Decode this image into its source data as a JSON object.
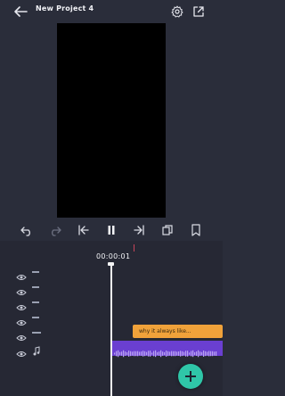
{
  "header": {
    "title": "New Project 4",
    "back_icon": "arrow-left-icon",
    "settings_icon": "gear-icon",
    "export_icon": "export-icon"
  },
  "controls": {
    "undo_icon": "undo-icon",
    "redo_icon": "redo-icon",
    "skip_start_icon": "skip-to-start-icon",
    "pause_icon": "pause-icon",
    "skip_end_icon": "skip-to-end-icon",
    "copy_icon": "copy-icon",
    "bookmark_icon": "bookmark-icon"
  },
  "timeline": {
    "timecode": "00:00:01",
    "tracks": [
      {
        "visibility_icon": "eye-icon"
      },
      {
        "visibility_icon": "eye-icon"
      },
      {
        "visibility_icon": "eye-icon"
      },
      {
        "visibility_icon": "eye-icon"
      },
      {
        "visibility_icon": "eye-icon"
      },
      {
        "visibility_icon": "eye-icon",
        "type_icon": "music-note-icon"
      }
    ],
    "caption_clip_text": "why it always like... ",
    "caption_clip_color": "#f0a23a",
    "audio_clip_color": "#6a3fd1"
  },
  "fab": {
    "icon": "plus-icon",
    "color": "#2fc6a8"
  },
  "colors": {
    "background": "#2a2d3a",
    "timeline_bg": "#262834",
    "preview_bg": "#000000"
  }
}
